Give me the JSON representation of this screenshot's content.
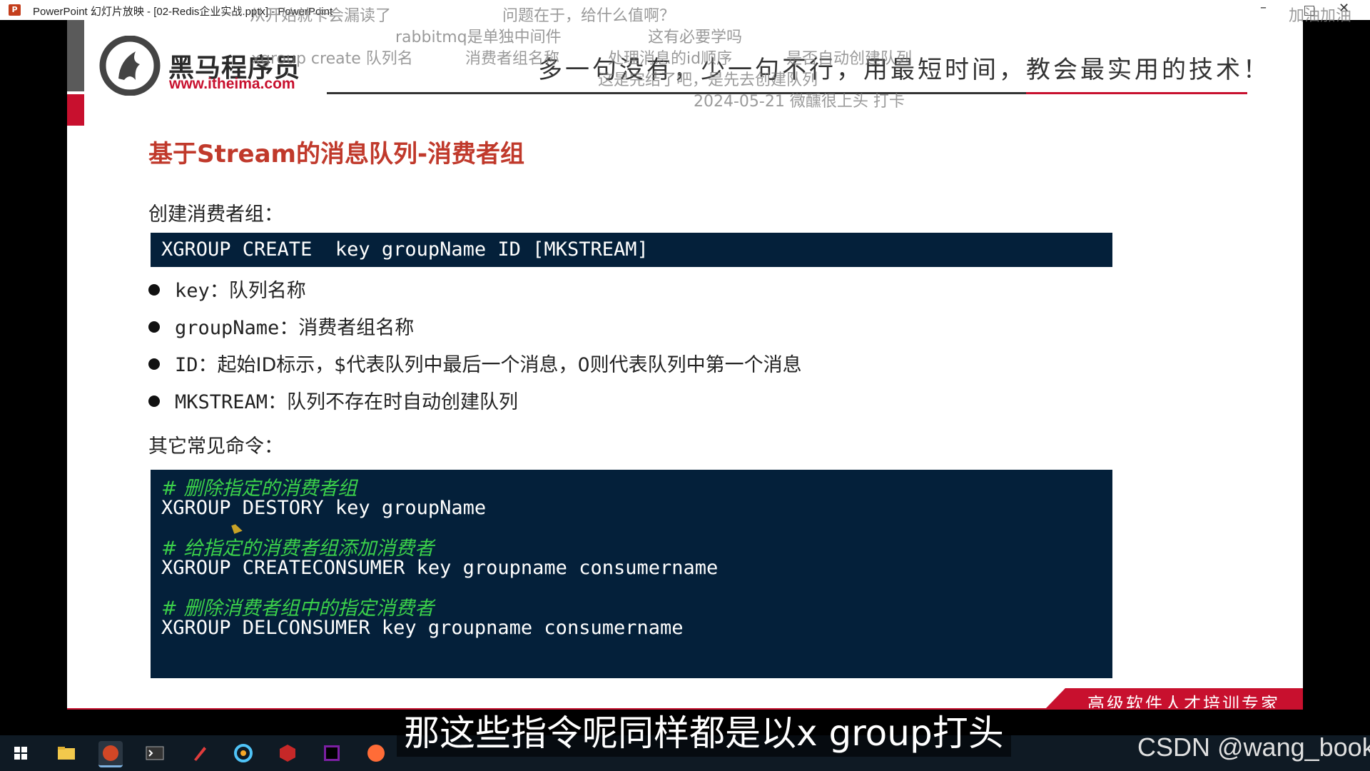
{
  "window": {
    "title": "PowerPoint 幻灯片放映 - [02-Redis企业实战.pptx] - PowerPoint",
    "app_icon": "P",
    "controls": {
      "minimize": "–",
      "close": "✕"
    }
  },
  "slide": {
    "logo": {
      "name_cn": "黑马程序员",
      "url": "www.itheima.com"
    },
    "slogan": "多一句没有，少一句不行，用最短时间，教会最实用的技术！",
    "heading": "基于Stream的消息队列-消费者组",
    "create_label": "创建消费者组：",
    "create_command": "XGROUP CREATE  key groupName ID [MKSTREAM]",
    "bullets": [
      {
        "key": "key",
        "desc": "：队列名称"
      },
      {
        "key": "groupName",
        "desc": "：消费者组名称"
      },
      {
        "key": "ID",
        "desc": "：起始ID标示，$代表队列中最后一个消息，0则代表队列中第一个消息"
      },
      {
        "key": "MKSTREAM",
        "desc": "：队列不存在时自动创建队列"
      }
    ],
    "other_label": "其它常见命令：",
    "code_lines": [
      {
        "comment": "# 删除指定的消费者组",
        "code": "XGROUP DESTORY key groupName"
      },
      {
        "comment": "# 给指定的消费者组添加消费者",
        "code": "XGROUP CREATECONSUMER key groupname consumername"
      },
      {
        "comment": "# 删除消费者组中的指定消费者",
        "code": "XGROUP DELCONSUMER key groupname consumername"
      }
    ],
    "footer": "高级软件人才培训专家"
  },
  "danmaku": [
    "从开始就卡会漏读了",
    "问题在于，给什么值啊？",
    "加油加油",
    "rabbitmq是单独中间件",
    "这有必要学吗",
    "xgroup create 队列名",
    "消费者组名称",
    "处理消息的id顺序",
    "是否自动创建队列",
    "这是完结了吧，是先去创建队列",
    "2024-05-21 微醺很上头 打卡"
  ],
  "subtitle": "那这些指令呢同样都是以x group打头",
  "watermark": "CSDN @wang_book",
  "taskbar": {
    "icons": [
      "windows-start-icon",
      "file-explorer-icon",
      "powerpoint-icon",
      "terminal-icon",
      "pen-icon",
      "browser-icon",
      "redis-desktop-icon",
      "intellij-icon",
      "postman-icon"
    ]
  },
  "colors": {
    "accent_red": "#c8102e",
    "code_bg": "#04203a",
    "comment_green": "#3bd14a"
  }
}
